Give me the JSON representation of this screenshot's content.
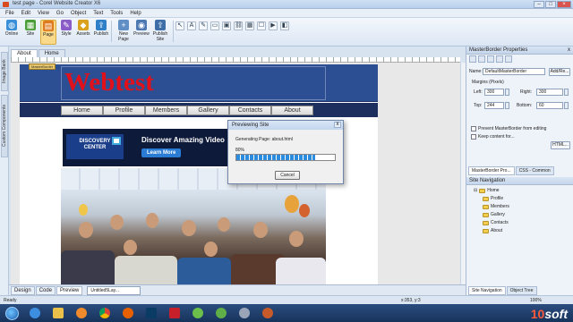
{
  "window": {
    "title": "test page - Corel Website Creator X6"
  },
  "menu": [
    "File",
    "Edit",
    "View",
    "Go",
    "Object",
    "Text",
    "Tools",
    "Help"
  ],
  "toolbar": {
    "buttons": [
      {
        "label": "Online",
        "icon": "globe-icon",
        "color": "#3a8fd9"
      },
      {
        "label": "Site",
        "icon": "site-icon",
        "color": "#4c9f38"
      },
      {
        "label": "Page",
        "icon": "page-icon",
        "color": "#e07a1f"
      },
      {
        "label": "Style",
        "icon": "style-icon",
        "color": "#8a5cc7"
      },
      {
        "label": "Assets",
        "icon": "assets-icon",
        "color": "#d9a11c"
      },
      {
        "label": "Publish",
        "icon": "publish-icon",
        "color": "#2f7fc9"
      },
      {
        "label": "New Page",
        "icon": "new-page-icon",
        "color": "#5f8fc4"
      },
      {
        "label": "Preview",
        "icon": "preview-icon",
        "color": "#4d79b3"
      },
      {
        "label": "Publish Site",
        "icon": "publish-site-icon",
        "color": "#3d6ea8"
      }
    ],
    "active": "Page"
  },
  "left_strip": {
    "tabs": [
      "Image Bank",
      "Custom Components"
    ]
  },
  "doc_tabs": [
    "About",
    "Home"
  ],
  "page": {
    "banner_title": "Webtest",
    "masterborder_tag": "MasterBorder",
    "nav": [
      "Home",
      "Profile",
      "Members",
      "Gallery",
      "Contacts",
      "About"
    ],
    "ad": {
      "logo_line1": "DISCOVERY",
      "logo_line2": "CENTER",
      "headline": "Discover Amazing Video",
      "button": "Learn More"
    }
  },
  "dialog": {
    "title": "Previewing Site",
    "message": "Generating Page: about.html",
    "percent_text": "80%",
    "progress": 0.8,
    "cancel": "Cancel",
    "close": "x"
  },
  "bottom": {
    "tabs": [
      "Design",
      "Code",
      "Preview"
    ],
    "active_tab": "Preview",
    "selector": "Untitled5Lay..."
  },
  "status": {
    "ready": "Ready",
    "coords": "x:353, y:3",
    "zoom": "100%"
  },
  "right_panel": {
    "title": "MasterBorder Properties",
    "close": "x",
    "name_label": "Name:",
    "name_value": "DefaultMasterBorder",
    "add_button": "Add/Re...",
    "margins_label": "Margins (Pixels)",
    "left_label": "Left:",
    "left_value": "300",
    "right_label": "Right:",
    "right_value": "300",
    "top_label": "Top:",
    "top_value": "244",
    "bottom_label": "Bottom:",
    "bottom_value": "60",
    "checkbox1": "Prevent MasterBorder from editing",
    "checkbox2": "Keep content for...",
    "html_button": "HTML...",
    "panel_tabs": [
      "MasterBorder Pro...",
      "CSS - Common"
    ],
    "site_nav_title": "Site Navigation",
    "tree_root": "Home",
    "tree_children": [
      "Profile",
      "Members",
      "Gallery",
      "Contacts",
      "About"
    ],
    "bottom_tabs": [
      "Site Navigation",
      "Object Tree"
    ]
  },
  "taskbar": {
    "apps": [
      "start-orb-icon",
      "ie-icon",
      "folder-icon",
      "media-player-icon",
      "chrome-icon",
      "firefox-icon",
      "photoshop-icon",
      "pdf-icon",
      "app-icon",
      "corel-icon",
      "disc-icon",
      "tool-icon"
    ],
    "watermark_a": "10",
    "watermark_b": "soft"
  }
}
